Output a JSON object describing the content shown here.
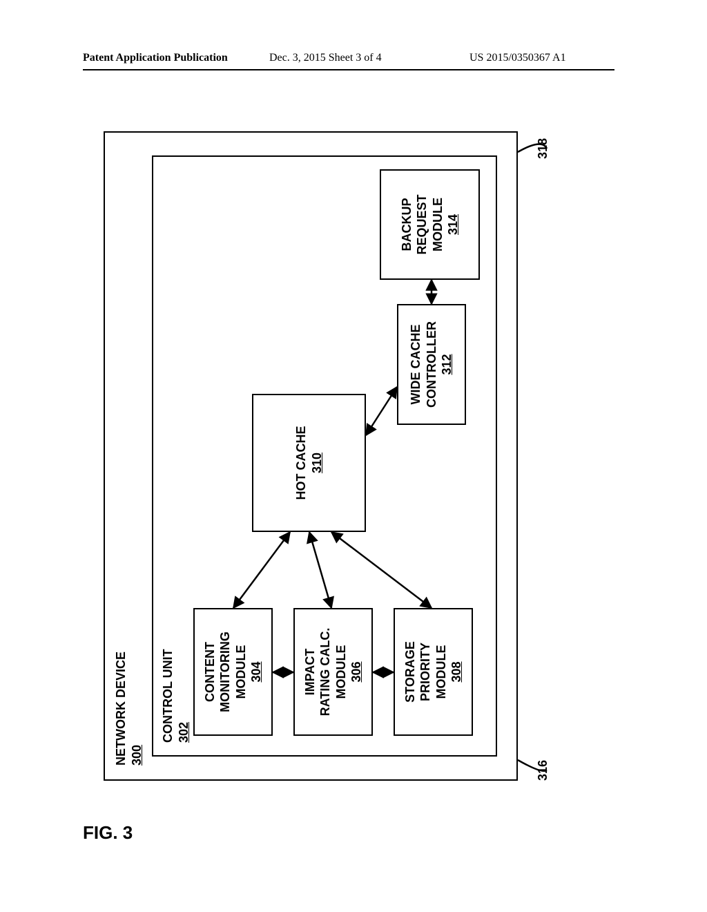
{
  "header": {
    "left": "Patent Application Publication",
    "mid": "Dec. 3, 2015   Sheet 3 of 4",
    "right": "US 2015/0350367 A1"
  },
  "figure_label": "FIG. 3",
  "diagram": {
    "outer": {
      "title": "NETWORK DEVICE",
      "ref": "300"
    },
    "control_unit": {
      "title": "CONTROL UNIT",
      "ref": "302"
    },
    "content_monitoring": {
      "l1": "CONTENT",
      "l2": "MONITORING",
      "l3": "MODULE",
      "ref": "304"
    },
    "impact_rating": {
      "l1": "IMPACT",
      "l2": "RATING CALC.",
      "l3": "MODULE",
      "ref": "306"
    },
    "storage_priority": {
      "l1": "STORAGE",
      "l2": "PRIORITY",
      "l3": "MODULE",
      "ref": "308"
    },
    "hot_cache": {
      "l1": "HOT CACHE",
      "ref": "310"
    },
    "wide_cache": {
      "l1": "WIDE CACHE",
      "l2": "CONTROLLER",
      "ref": "312"
    },
    "backup_request": {
      "l1": "BACKUP",
      "l2": "REQUEST",
      "l3": "MODULE",
      "ref": "314"
    },
    "conn316": "316",
    "conn318": "318"
  }
}
